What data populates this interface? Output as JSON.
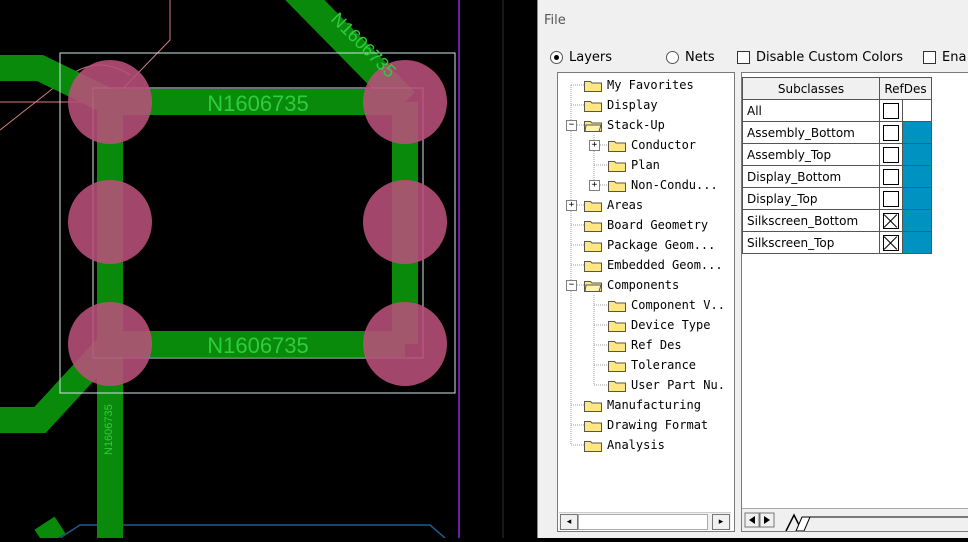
{
  "pcb": {
    "net_label_top": "N1606735",
    "net_label_bottom": "N1606735",
    "net_label_diag": "N1606735",
    "net_label_vert": "N1606735"
  },
  "panel": {
    "menu": {
      "file": "File"
    },
    "options": {
      "layers": "Layers",
      "nets": "Nets",
      "disable_custom_colors": "Disable Custom Colors",
      "enable": "Ena"
    },
    "tree": [
      {
        "label": "My Favorites"
      },
      {
        "label": "Display"
      },
      {
        "label": "Stack-Up"
      },
      {
        "label": "Conductor"
      },
      {
        "label": "Plan"
      },
      {
        "label": "Non-Condu..."
      },
      {
        "label": "Areas"
      },
      {
        "label": "Board Geometry"
      },
      {
        "label": "Package Geom..."
      },
      {
        "label": "Embedded Geom..."
      },
      {
        "label": "Components"
      },
      {
        "label": "Component V.."
      },
      {
        "label": "Device Type"
      },
      {
        "label": "Ref Des"
      },
      {
        "label": "Tolerance"
      },
      {
        "label": "User Part Nu."
      },
      {
        "label": "Manufacturing"
      },
      {
        "label": "Drawing Format"
      },
      {
        "label": "Analysis"
      }
    ],
    "grid": {
      "headers": {
        "subclasses": "Subclasses",
        "refdes": "RefDes"
      },
      "rows": [
        {
          "name": "All",
          "checked": false
        },
        {
          "name": "Assembly_Bottom",
          "checked": false
        },
        {
          "name": "Assembly_Top",
          "checked": false
        },
        {
          "name": "Display_Bottom",
          "checked": false
        },
        {
          "name": "Display_Top",
          "checked": false
        },
        {
          "name": "Silkscreen_Bottom",
          "checked": true
        },
        {
          "name": "Silkscreen_Top",
          "checked": true
        }
      ],
      "color": "#0093c2"
    }
  },
  "colors": {
    "trace": "#0a8a0a",
    "pad": "#b04070",
    "pad_fill": "#c05a80",
    "outline": "#cfe6e6",
    "grid_accent": "#0093c2"
  }
}
